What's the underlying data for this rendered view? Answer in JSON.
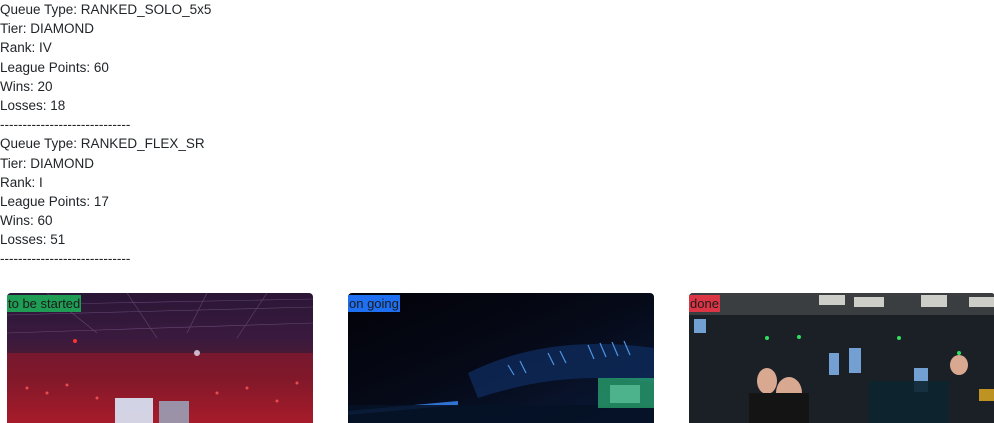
{
  "queues": [
    {
      "queue_type": "Queue Type: RANKED_SOLO_5x5",
      "tier": "Tier: DIAMOND",
      "rank": "Rank: IV",
      "league_points": "League Points: 60",
      "wins": "Wins: 20",
      "losses": "Losses: 18",
      "separator": "-----------------------------"
    },
    {
      "queue_type": "Queue Type: RANKED_FLEX_SR",
      "tier": "Tier: DIAMOND",
      "rank": "Rank: I",
      "league_points": "League Points: 17",
      "wins": "Wins: 60",
      "losses": "Losses: 51",
      "separator": "-----------------------------"
    }
  ],
  "cards": [
    {
      "status": "to be started",
      "status_color": "#1f9d55",
      "image": "arena-stadium-crowd-image"
    },
    {
      "status": "on going",
      "status_color": "#1e6ff2",
      "image": "esports-stage-lights-image"
    },
    {
      "status": "done",
      "status_color": "#dc3545",
      "image": "gaming-lan-hall-image"
    }
  ]
}
